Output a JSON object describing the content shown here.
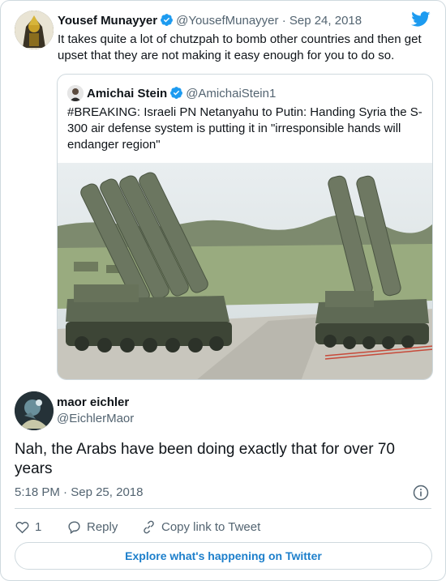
{
  "parent": {
    "name": "Yousef Munayyer",
    "handle": "@YousefMunayyer",
    "separator": "·",
    "date": "Sep 24, 2018",
    "text": "It takes quite a lot of chutzpah to bomb other countries and then get upset that they are not making it easy enough for you to do so."
  },
  "quote": {
    "name": "Amichai Stein",
    "handle": "@AmichaiStein1",
    "text": "#BREAKING: Israeli PN Netanyahu to Putin: Handing Syria the S-300 air defense system is putting it in \"irresponsible hands will endanger region\""
  },
  "reply": {
    "name": "maor eichler",
    "handle": "@EichlerMaor",
    "text": "Nah, the Arabs have been doing exactly that for over 70 years",
    "time": "5:18 PM",
    "separator": "·",
    "date": "Sep 25, 2018"
  },
  "actions": {
    "like_count": "1",
    "reply_label": "Reply",
    "copy_label": "Copy link to Tweet"
  },
  "explore_label": "Explore what's happening on Twitter",
  "colors": {
    "twitter_blue": "#1d9bf0",
    "link": "#1d7fcb",
    "muted": "#536471",
    "border": "#cfd9de"
  },
  "icons": [
    "verified-icon",
    "twitter-bird-icon",
    "info-icon",
    "heart-icon",
    "reply-icon",
    "link-icon"
  ]
}
